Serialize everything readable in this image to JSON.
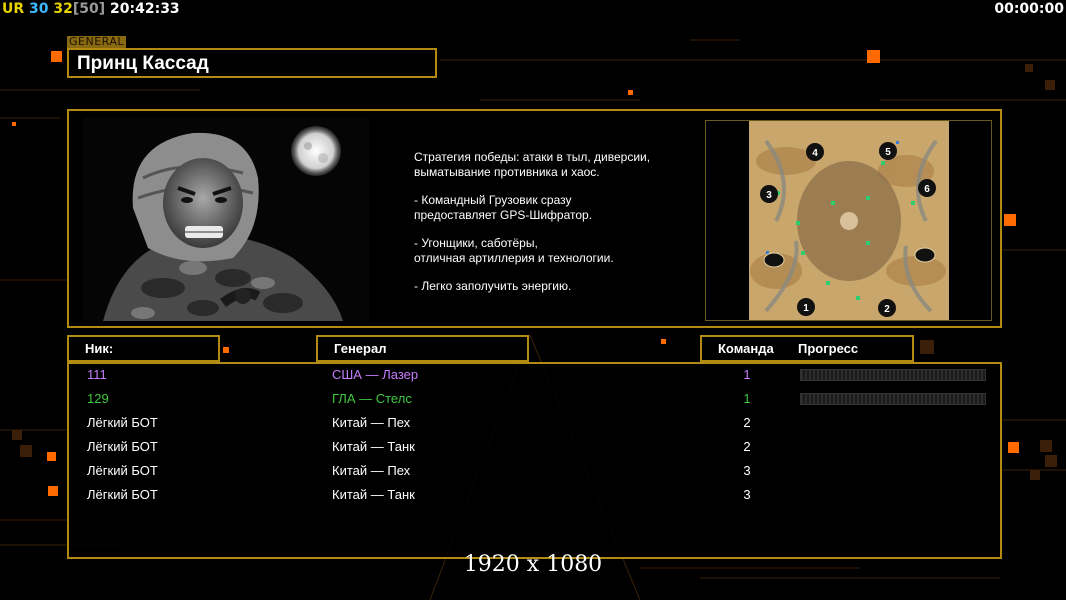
{
  "hud": {
    "ur_label": "UR",
    "stat_a": "30",
    "stat_b": "32",
    "stat_c": "[50]",
    "clock": "20:42:33",
    "timer": "00:00:00"
  },
  "general": {
    "tag": "GENERAL",
    "name": "Принц Кассад"
  },
  "strategy": [
    "Стратегия победы: атаки в тыл, диверсии,\n выматывание противника и хаос.",
    "- Командный Грузовик сразу\nпредоставляет GPS-Шифратор.",
    "- Угонщики, саботёры,\nотличная артиллерия и технологии.",
    "- Легко заполучить энергию."
  ],
  "map": {
    "start_positions": [
      "1",
      "2",
      "3",
      "4",
      "5",
      "6"
    ]
  },
  "table": {
    "headers": {
      "nick": "Ник:",
      "general": "Генерал",
      "team": "Команда",
      "progress": "Прогресс"
    },
    "rows": [
      {
        "nick": "111",
        "general": "США — Лазер",
        "team": "1",
        "color": "#c77dff",
        "show_progress": true,
        "progress": 0
      },
      {
        "nick": "129",
        "general": "ГЛА — Стелс",
        "team": "1",
        "color": "#3ec83e",
        "show_progress": true,
        "progress": 0
      },
      {
        "nick": "Лёгкий БОТ",
        "general": "Китай — Пех",
        "team": "2",
        "color": "#ffffff",
        "show_progress": false
      },
      {
        "nick": "Лёгкий БОТ",
        "general": "Китай — Танк",
        "team": "2",
        "color": "#ffffff",
        "show_progress": false
      },
      {
        "nick": "Лёгкий БОТ",
        "general": "Китай — Пех",
        "team": "3",
        "color": "#ffffff",
        "show_progress": false
      },
      {
        "nick": "Лёгкий БОТ",
        "general": "Китай — Танк",
        "team": "3",
        "color": "#ffffff",
        "show_progress": false
      }
    ]
  },
  "resolution_label": "1920 x 1080",
  "colors": {
    "frame": "#b38a12",
    "accent_orange": "#ff6a00"
  }
}
